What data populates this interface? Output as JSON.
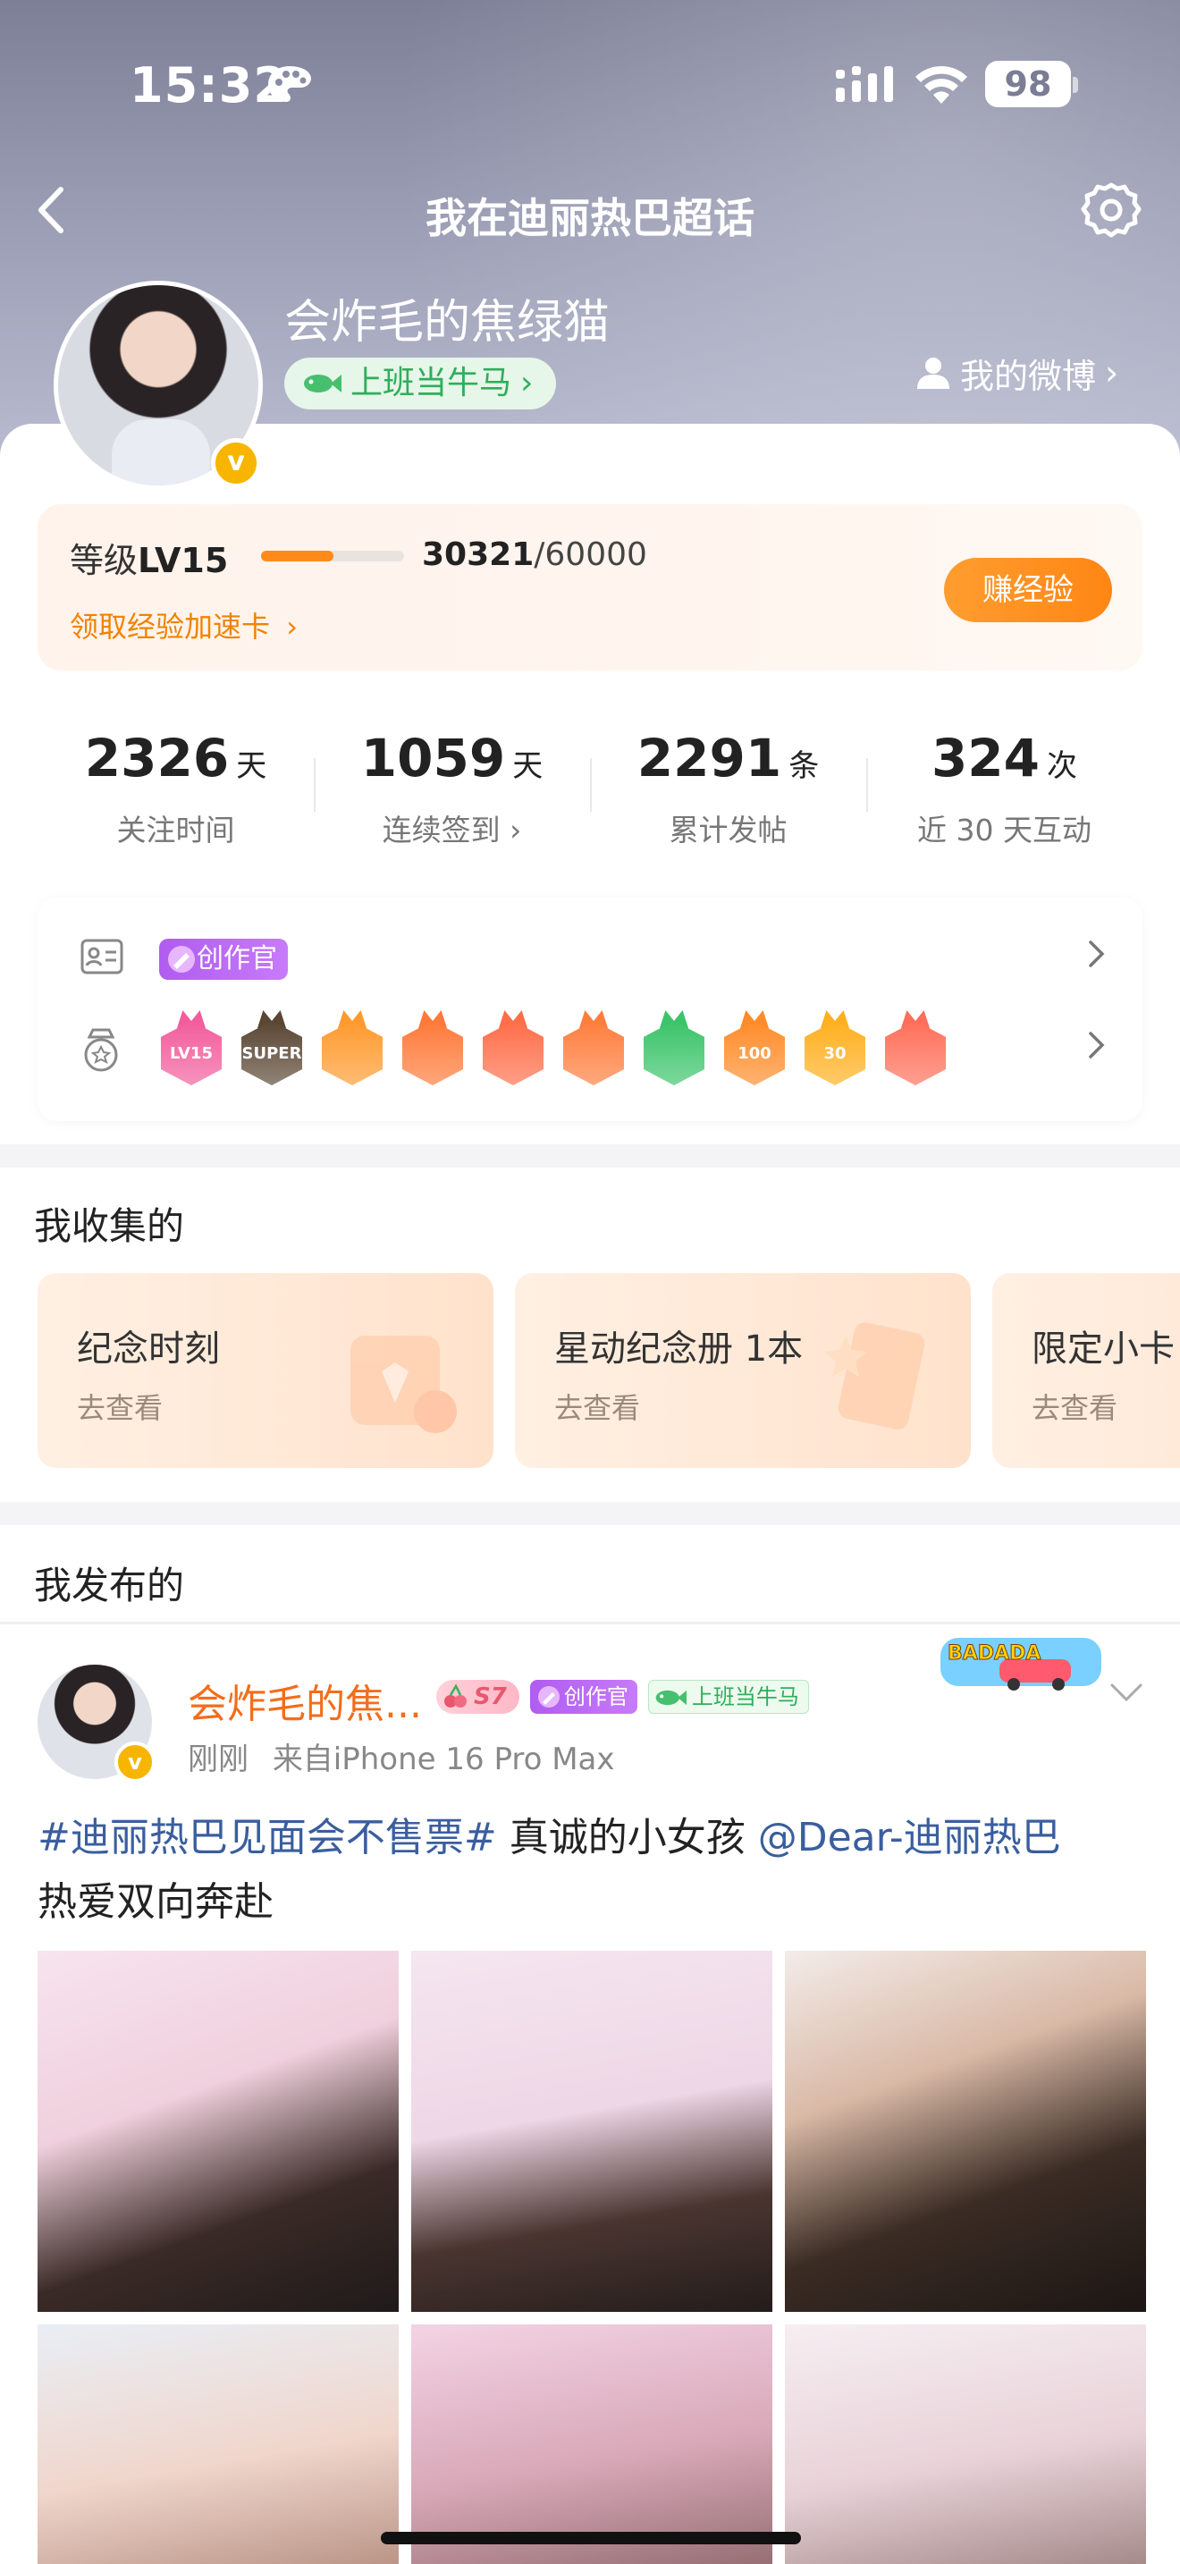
{
  "status_bar": {
    "time": "15:32",
    "battery": "98"
  },
  "nav": {
    "title": "我在迪丽热巴超话"
  },
  "profile": {
    "username": "会炸毛的焦绿猫",
    "tag": "上班当牛马",
    "my_weibo": "我的微博",
    "verified_mark": "v"
  },
  "level": {
    "prefix": "等级",
    "value": "LV15",
    "current": "30321",
    "total": "/60000",
    "progress_fraction": 0.505,
    "exp_card_link": "领取经验加速卡",
    "earn_button": "赚经验"
  },
  "stats": [
    {
      "value": "2326",
      "unit": "天",
      "label": "关注时间"
    },
    {
      "value": "1059",
      "unit": "天",
      "label": "连续签到 ›"
    },
    {
      "value": "2291",
      "unit": "条",
      "label": "累计发帖"
    },
    {
      "value": "324",
      "unit": "次",
      "label": "近 30 天互动"
    }
  ],
  "badges": {
    "creator": "创作官",
    "medals": [
      {
        "text": "LV15",
        "color": "#f25d9c"
      },
      {
        "text": "SUPER",
        "color": "#5a4633"
      },
      {
        "text": "",
        "color": "#ff9a2e"
      },
      {
        "text": "",
        "color": "#ff7a3a"
      },
      {
        "text": "",
        "color": "#ff6e4a"
      },
      {
        "text": "",
        "color": "#ff7e3e"
      },
      {
        "text": "",
        "color": "#3cc46a"
      },
      {
        "text": "100",
        "color": "#ff8c2a"
      },
      {
        "text": "30",
        "color": "#ffb020"
      },
      {
        "text": "",
        "color": "#ff6f5a"
      }
    ]
  },
  "collections_section": {
    "title": "我收集的",
    "cards": [
      {
        "title": "纪念时刻",
        "link": "去查看"
      },
      {
        "title": "星动纪念册 1本",
        "link": "去查看"
      },
      {
        "title": "限定小卡",
        "link": "去查看"
      }
    ]
  },
  "posts_section": {
    "title": "我发布的"
  },
  "post": {
    "author": "会炸毛的焦...",
    "badge_s7": "S7",
    "badge_creator": "创作官",
    "badge_work": "上班当牛马",
    "sticker": "BADADA",
    "time": "刚刚",
    "source": "来自iPhone 16 Pro Max",
    "topic": "#迪丽热巴见面会不售票#",
    "text_mid": " 真诚的小女孩 ",
    "mention": "@Dear-迪丽热巴",
    "text_end": "热爱双向奔赴"
  },
  "colors": {
    "accent_orange": "#ff8a1a",
    "link_blue": "#3a5e9e",
    "green_tag": "#2fae5c",
    "creator_purple": "#b05cf0",
    "header_bg": "#9a9cb4"
  }
}
